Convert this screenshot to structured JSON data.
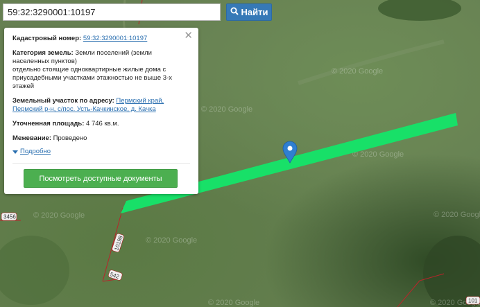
{
  "search": {
    "value": "59:32:3290001:10197",
    "button_label": "Найти"
  },
  "popup": {
    "cadastral_label": "Кадастровый номер:",
    "cadastral_value": "59:32:3290001:10197",
    "category_label": "Категория земель:",
    "category_value": "Земли поселений (земли населенных пунктов)",
    "permitted_use": "отдельно стоящие одноквартирные жилые дома с приусадебными участками этажностью не выше 3-х этажей",
    "address_label": "Земельный участок по адресу:",
    "address_value": "Пермский край, Пермский р-н, с/пос. Усть-Качкинское, д. Качка",
    "area_label": "Уточненная площадь:",
    "area_value": "4 746 кв.м.",
    "survey_label": "Межевание:",
    "survey_value": "Проведено",
    "more_label": "Подробно",
    "docs_button": "Посмотреть доступные документы"
  },
  "map": {
    "parcel_color": "#18e068",
    "watermark": "© 2020 Google",
    "parcel_labels": [
      "3456",
      "10198",
      "542",
      "101"
    ]
  },
  "colors": {
    "accent": "#3679b7",
    "button_green": "#4caf50",
    "marker": "#2f7fd0"
  }
}
